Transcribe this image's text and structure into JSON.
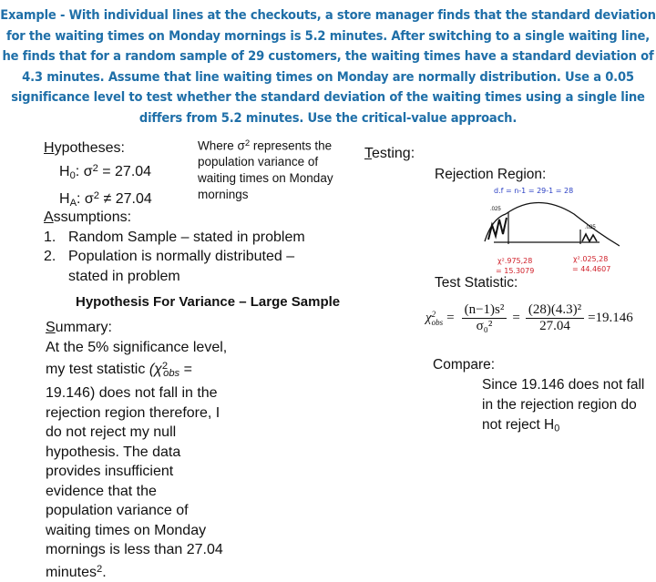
{
  "problem": {
    "text": "Example - With individual lines at the checkouts, a store manager finds that the standard deviation for the waiting times on Monday mornings is 5.2 minutes. After switching to a single waiting line, he finds that for a random sample of 29 customers, the waiting times have a standard deviation of 4.3 minutes. Assume that line waiting times on Monday are normally distribution.  Use a 0.05 significance level to test whether the standard deviation of the waiting times using a single line differs from 5.2 minutes. Use the critical-value approach.",
    "color": "#1f6fa8"
  },
  "hypotheses": {
    "heading_first": "H",
    "heading_rest": "ypotheses:",
    "h0_label": "H",
    "h0_sub": "0",
    "h0_rest": ": σ",
    "h0_sup": "2",
    "h0_value": " = 27.04",
    "ha_label": "H",
    "ha_sub": "A",
    "ha_rest": ": σ",
    "ha_sup": "2",
    "ha_value": " ≠ 27.04"
  },
  "where_note": {
    "pre": "Where σ",
    "sup": "2",
    "post": " represents the population variance of waiting times on Monday mornings"
  },
  "assumptions": {
    "heading_first": "A",
    "heading_rest": "ssumptions:",
    "items": [
      {
        "num": "1.",
        "text": "Random Sample – stated in problem"
      },
      {
        "num": "2.",
        "text": "Population is normally distributed – stated in problem"
      }
    ]
  },
  "section_title": "Hypothesis For Variance – Large Sample",
  "summary": {
    "heading_first": "S",
    "heading_rest": "ummary:",
    "line1": "At the 5% significance level, my test statistic",
    "stat_open": "(χ",
    "stat_sup": "2",
    "stat_sub": "obs",
    "stat_rest": " = 19.146) does not fall in the rejection region therefore, I do not reject my null hypothesis.  The data provides insufficient evidence that the population variance of waiting times on Monday mornings is less than 27.04 minutes",
    "end_sup": "2",
    "end": "."
  },
  "testing": {
    "heading_first": "T",
    "heading_rest": "esting:",
    "rejection_region_label": "Rejection Region:",
    "sketch": {
      "df_note": "d.f = n-1 = 29-1 = 28",
      "left_tail_area": ".025",
      "right_tail_area": ".025",
      "left_critical_label": "χ².975,28",
      "left_critical_value": "= 15.3079",
      "right_critical_label": "χ².025,28",
      "right_critical_value": "= 44.4607"
    },
    "test_statistic_label": "Test Statistic:",
    "formula": {
      "lhs": "χ",
      "lhs_sup": "2",
      "lhs_sub": "obs",
      "num1": "(n−1)s²",
      "den1": "σ₀²",
      "num2": "(28)(4.3)²",
      "den2": "27.04",
      "result": "=19.146"
    }
  },
  "compare": {
    "heading": "Compare:",
    "body": "Since 19.146 does not fall in the rejection region do not reject H",
    "body_sub": "0"
  }
}
